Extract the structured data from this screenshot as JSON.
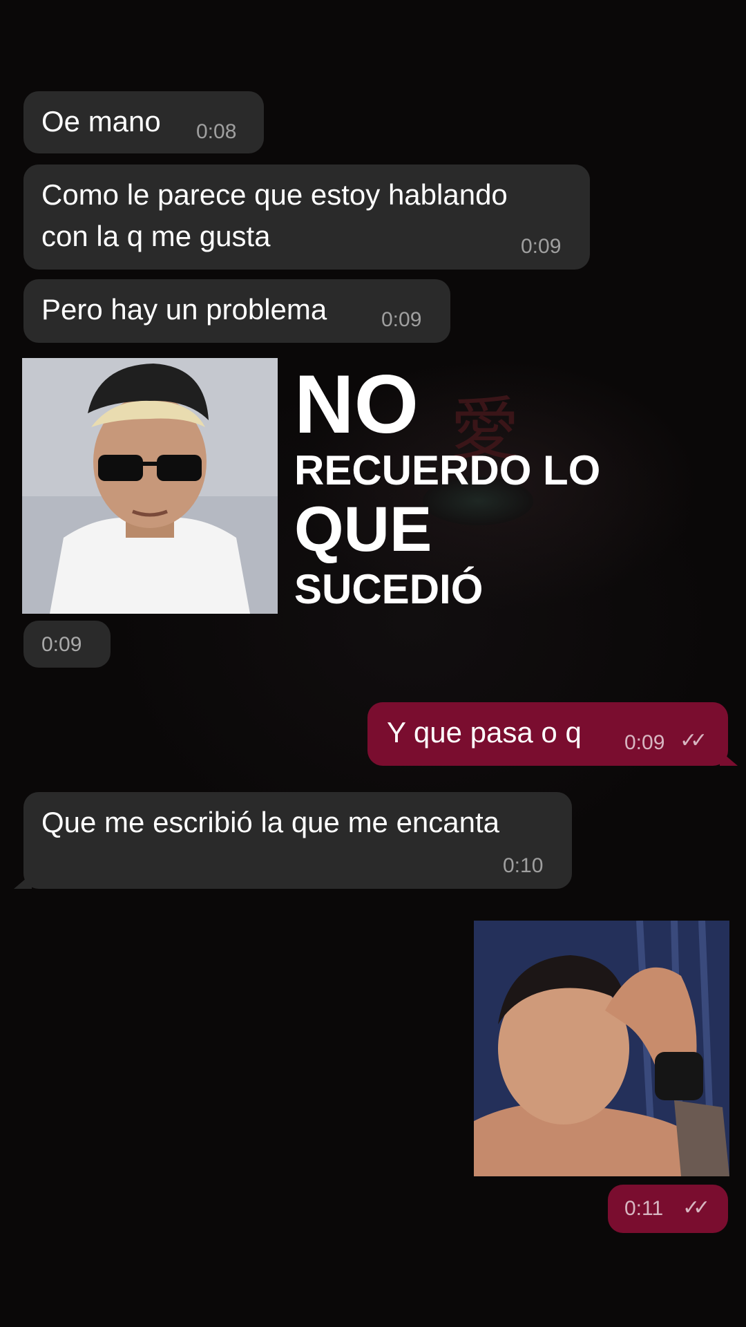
{
  "messages": [
    {
      "text": "Oe mano",
      "time": "0:08"
    },
    {
      "text": "Como le parece que estoy hablando",
      "text2": "con la q me gusta",
      "time": "0:09"
    },
    {
      "text": "Pero hay un problema",
      "time": "0:09"
    },
    {
      "meme_line1": "NO",
      "meme_line2": "RECUERDO LO",
      "meme_line3": "QUE",
      "meme_line4": "SUCEDIÓ",
      "time": "0:09"
    },
    {
      "text": "Y que pasa o q",
      "time": "0:09"
    },
    {
      "text": "Que me escribió la que me encanta",
      "time": "0:10"
    },
    {
      "time": "0:11"
    }
  ],
  "wallpaper": {
    "kanji": "愛"
  },
  "colors": {
    "incoming": "#2a2a2a",
    "outgoing": "#7a0d2f",
    "background": "#0a0808"
  },
  "icons": {
    "read_receipt": "double-check-icon"
  }
}
